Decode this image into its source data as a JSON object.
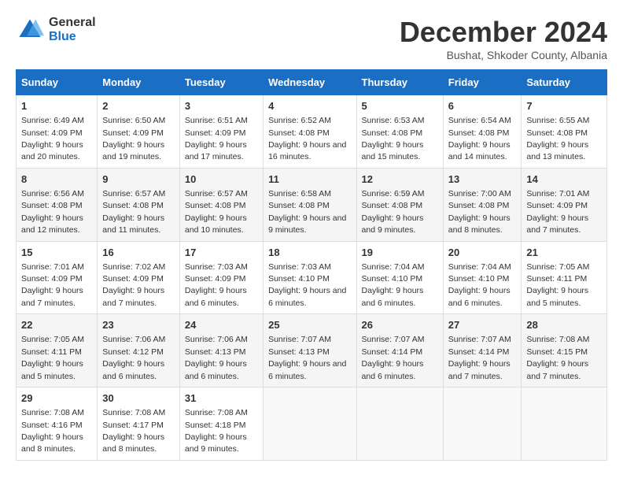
{
  "logo": {
    "general": "General",
    "blue": "Blue"
  },
  "title": "December 2024",
  "subtitle": "Bushat, Shkoder County, Albania",
  "days_header": [
    "Sunday",
    "Monday",
    "Tuesday",
    "Wednesday",
    "Thursday",
    "Friday",
    "Saturday"
  ],
  "weeks": [
    [
      {
        "day": "1",
        "sunrise": "6:49 AM",
        "sunset": "4:09 PM",
        "daylight": "9 hours and 20 minutes."
      },
      {
        "day": "2",
        "sunrise": "6:50 AM",
        "sunset": "4:09 PM",
        "daylight": "9 hours and 19 minutes."
      },
      {
        "day": "3",
        "sunrise": "6:51 AM",
        "sunset": "4:09 PM",
        "daylight": "9 hours and 17 minutes."
      },
      {
        "day": "4",
        "sunrise": "6:52 AM",
        "sunset": "4:08 PM",
        "daylight": "9 hours and 16 minutes."
      },
      {
        "day": "5",
        "sunrise": "6:53 AM",
        "sunset": "4:08 PM",
        "daylight": "9 hours and 15 minutes."
      },
      {
        "day": "6",
        "sunrise": "6:54 AM",
        "sunset": "4:08 PM",
        "daylight": "9 hours and 14 minutes."
      },
      {
        "day": "7",
        "sunrise": "6:55 AM",
        "sunset": "4:08 PM",
        "daylight": "9 hours and 13 minutes."
      }
    ],
    [
      {
        "day": "8",
        "sunrise": "6:56 AM",
        "sunset": "4:08 PM",
        "daylight": "9 hours and 12 minutes."
      },
      {
        "day": "9",
        "sunrise": "6:57 AM",
        "sunset": "4:08 PM",
        "daylight": "9 hours and 11 minutes."
      },
      {
        "day": "10",
        "sunrise": "6:57 AM",
        "sunset": "4:08 PM",
        "daylight": "9 hours and 10 minutes."
      },
      {
        "day": "11",
        "sunrise": "6:58 AM",
        "sunset": "4:08 PM",
        "daylight": "9 hours and 9 minutes."
      },
      {
        "day": "12",
        "sunrise": "6:59 AM",
        "sunset": "4:08 PM",
        "daylight": "9 hours and 9 minutes."
      },
      {
        "day": "13",
        "sunrise": "7:00 AM",
        "sunset": "4:08 PM",
        "daylight": "9 hours and 8 minutes."
      },
      {
        "day": "14",
        "sunrise": "7:01 AM",
        "sunset": "4:09 PM",
        "daylight": "9 hours and 7 minutes."
      }
    ],
    [
      {
        "day": "15",
        "sunrise": "7:01 AM",
        "sunset": "4:09 PM",
        "daylight": "9 hours and 7 minutes."
      },
      {
        "day": "16",
        "sunrise": "7:02 AM",
        "sunset": "4:09 PM",
        "daylight": "9 hours and 7 minutes."
      },
      {
        "day": "17",
        "sunrise": "7:03 AM",
        "sunset": "4:09 PM",
        "daylight": "9 hours and 6 minutes."
      },
      {
        "day": "18",
        "sunrise": "7:03 AM",
        "sunset": "4:10 PM",
        "daylight": "9 hours and 6 minutes."
      },
      {
        "day": "19",
        "sunrise": "7:04 AM",
        "sunset": "4:10 PM",
        "daylight": "9 hours and 6 minutes."
      },
      {
        "day": "20",
        "sunrise": "7:04 AM",
        "sunset": "4:10 PM",
        "daylight": "9 hours and 6 minutes."
      },
      {
        "day": "21",
        "sunrise": "7:05 AM",
        "sunset": "4:11 PM",
        "daylight": "9 hours and 5 minutes."
      }
    ],
    [
      {
        "day": "22",
        "sunrise": "7:05 AM",
        "sunset": "4:11 PM",
        "daylight": "9 hours and 5 minutes."
      },
      {
        "day": "23",
        "sunrise": "7:06 AM",
        "sunset": "4:12 PM",
        "daylight": "9 hours and 6 minutes."
      },
      {
        "day": "24",
        "sunrise": "7:06 AM",
        "sunset": "4:13 PM",
        "daylight": "9 hours and 6 minutes."
      },
      {
        "day": "25",
        "sunrise": "7:07 AM",
        "sunset": "4:13 PM",
        "daylight": "9 hours and 6 minutes."
      },
      {
        "day": "26",
        "sunrise": "7:07 AM",
        "sunset": "4:14 PM",
        "daylight": "9 hours and 6 minutes."
      },
      {
        "day": "27",
        "sunrise": "7:07 AM",
        "sunset": "4:14 PM",
        "daylight": "9 hours and 7 minutes."
      },
      {
        "day": "28",
        "sunrise": "7:08 AM",
        "sunset": "4:15 PM",
        "daylight": "9 hours and 7 minutes."
      }
    ],
    [
      {
        "day": "29",
        "sunrise": "7:08 AM",
        "sunset": "4:16 PM",
        "daylight": "9 hours and 8 minutes."
      },
      {
        "day": "30",
        "sunrise": "7:08 AM",
        "sunset": "4:17 PM",
        "daylight": "9 hours and 8 minutes."
      },
      {
        "day": "31",
        "sunrise": "7:08 AM",
        "sunset": "4:18 PM",
        "daylight": "9 hours and 9 minutes."
      },
      null,
      null,
      null,
      null
    ]
  ]
}
